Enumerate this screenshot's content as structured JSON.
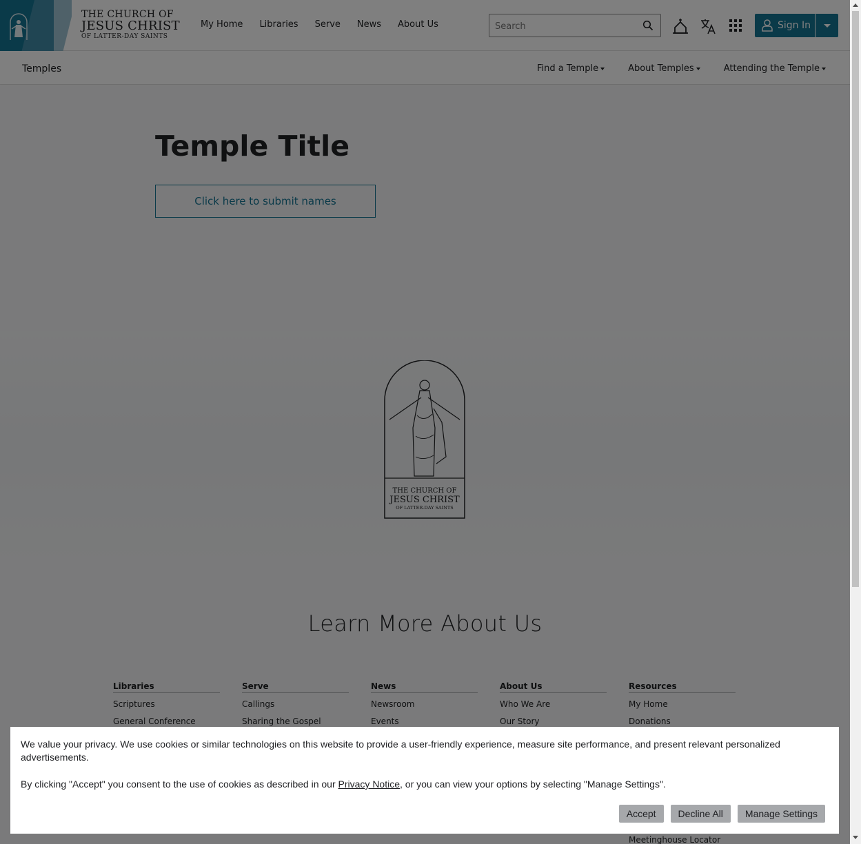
{
  "header": {
    "logo": {
      "line1": "THE CHURCH OF",
      "line2": "JESUS CHRIST",
      "line3": "OF LATTER-DAY SAINTS"
    },
    "nav": [
      "My Home",
      "Libraries",
      "Serve",
      "News",
      "About Us"
    ],
    "search_placeholder": "Search",
    "icons": [
      "meetinghouse-icon",
      "translate-icon",
      "apps-grid-icon"
    ],
    "sign_in_label": "Sign In"
  },
  "subnav": {
    "brand": "Temples",
    "links": [
      "Find a Temple",
      "About Temples",
      "Attending the Temple"
    ]
  },
  "main": {
    "title": "Temple Title",
    "submit_button": "Click here to submit names",
    "emblem": {
      "line1": "THE CHURCH OF",
      "line2": "JESUS CHRIST",
      "line3": "OF LATTER-DAY SAINTS"
    }
  },
  "footer": {
    "heading": "Learn More About Us",
    "columns": [
      {
        "title": "Libraries",
        "items": [
          "Scriptures",
          "General Conference"
        ]
      },
      {
        "title": "Serve",
        "items": [
          "Callings",
          "Sharing the Gospel"
        ]
      },
      {
        "title": "News",
        "items": [
          "Newsroom",
          "Events"
        ]
      },
      {
        "title": "About Us",
        "items": [
          "Who We Are",
          "Our Story"
        ]
      },
      {
        "title": "Resources",
        "items": [
          "My Home",
          "Donations"
        ]
      }
    ],
    "extra_link": "Meetinghouse Locator"
  },
  "cookie_banner": {
    "paragraph1": "We value your privacy. We use cookies or similar technologies on this website to provide a user-friendly experience, measure site performance, and present relevant personalized advertisements.",
    "paragraph2_before": "By clicking \"Accept\" you consent to the use of cookies as described in our ",
    "privacy_link": "Privacy Notice",
    "paragraph2_after": ", or you can view your options by selecting \"Manage Settings\".",
    "buttons": {
      "accept": "Accept",
      "decline": "Decline All",
      "manage": "Manage Settings"
    }
  },
  "colors": {
    "brand_blue": "#157493",
    "overlay": "rgba(0,0,0,0.5)"
  }
}
